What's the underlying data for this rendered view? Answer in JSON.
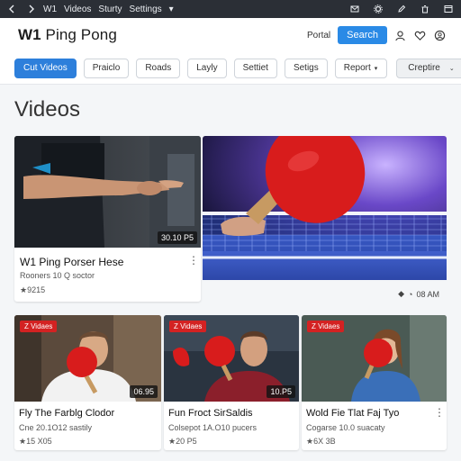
{
  "topbar": {
    "nav": [
      "W1",
      "Videos",
      "Sturty",
      "Settings"
    ],
    "dropdown_caret": "▾"
  },
  "header": {
    "brand_bold": "W1",
    "brand_rest": " Ping Pong",
    "portal_label": "Portal",
    "search_label": "Search"
  },
  "tabs": [
    {
      "label": "Cut Videos",
      "active": true
    },
    {
      "label": "Praiclo"
    },
    {
      "label": "Roads"
    },
    {
      "label": "Layly"
    },
    {
      "label": "Settiet"
    },
    {
      "label": "Setigs"
    },
    {
      "label": "Report",
      "dropdown": true
    },
    {
      "label": "Creptire",
      "dropdown": true
    }
  ],
  "page_title": "Videos",
  "featured": [
    {
      "duration": "30.10 P5",
      "title": "W1 Ping Porser Hese",
      "meta": "Rooners 10 Q soctor",
      "views": "★9215"
    },
    {
      "stats": "08 AM"
    }
  ],
  "grid": [
    {
      "live": "Z Vidaes",
      "duration": "06.95",
      "title": "Fly The Farblg Clodor",
      "meta": "Cne 20.1O12 sastily",
      "views": "★15 X05"
    },
    {
      "live": "Z Vidaes",
      "duration": "10.P5",
      "title": "Fun Froct SirSaldis",
      "meta": "Colsepot 1A.O10 pucers",
      "views": "★20 P5"
    },
    {
      "live": "Z Vidaes",
      "duration": "",
      "title": "Wold Fie Tlat Faj Tyo",
      "meta": "Cogarse 10.0 suacaty",
      "views": "★6X 3B"
    }
  ],
  "colors": {
    "accent": "#2d7fdb",
    "live_badge": "#d32222",
    "paddle_red": "#d81c1c",
    "table_blue": "#3a5ec7"
  }
}
